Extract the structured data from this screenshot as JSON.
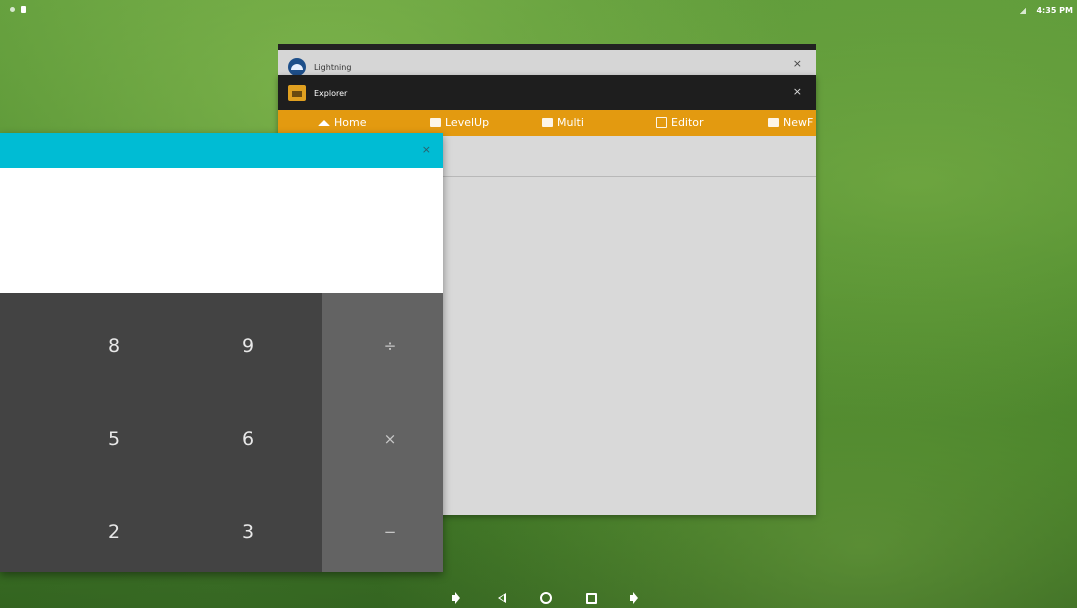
{
  "status_bar": {
    "time": "4:35 PM"
  },
  "windows": {
    "lightning": {
      "title": "Lightning",
      "close": "×"
    },
    "explorer": {
      "title": "Explorer",
      "close": "×",
      "toolbar": [
        {
          "label": "Home",
          "icon": "home-icon"
        },
        {
          "label": "LevelUp",
          "icon": "folder-up-icon"
        },
        {
          "label": "Multi",
          "icon": "multi-select-icon"
        },
        {
          "label": "Editor",
          "icon": "edit-icon"
        },
        {
          "label": "NewF",
          "icon": "new-folder-icon"
        }
      ]
    },
    "calculator": {
      "close": "×",
      "keys": [
        "8",
        "9",
        "5",
        "6",
        "2",
        "3"
      ],
      "ops": [
        "÷",
        "×",
        "−"
      ]
    }
  },
  "colors": {
    "calculator_title": "#00bcd4",
    "explorer_toolbar": "#e39a10",
    "numpad": "#434343",
    "oppad": "#636363"
  }
}
